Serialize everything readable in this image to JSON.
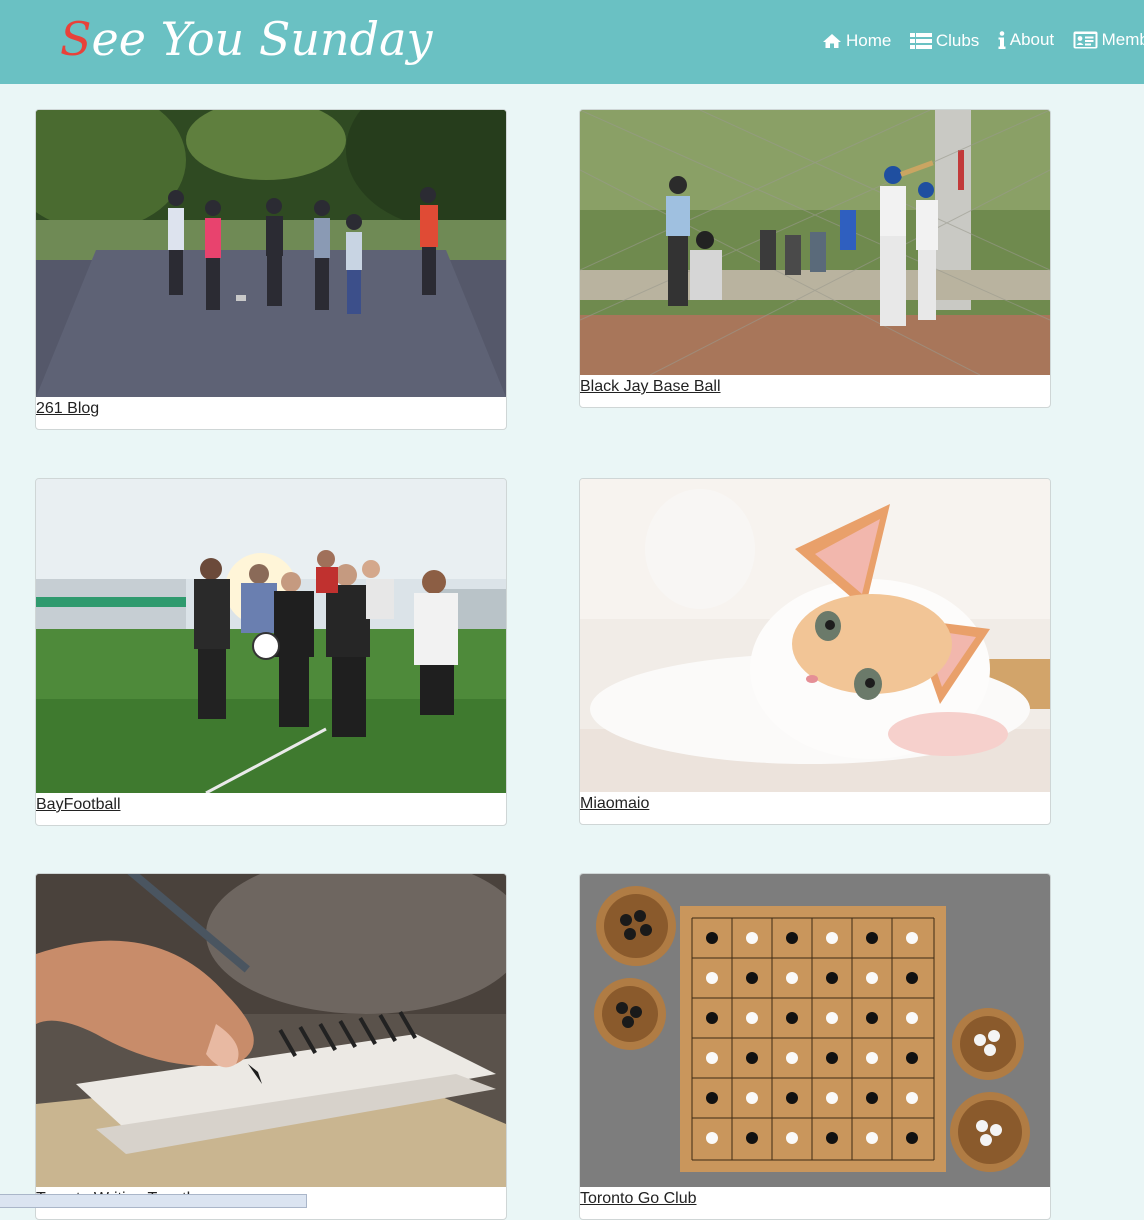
{
  "brand": {
    "first_letter": "S",
    "rest": "ee You Sunday"
  },
  "nav": {
    "home": "Home",
    "clubs": "Clubs",
    "about": "About",
    "members": "Membe"
  },
  "clubs": [
    {
      "name": "261 Blog"
    },
    {
      "name": "Black Jay Base Ball"
    },
    {
      "name": "BayFootball"
    },
    {
      "name": "Miaomaio"
    },
    {
      "name": "Toronto Writing Together"
    },
    {
      "name": "Toronto Go Club"
    }
  ],
  "colors": {
    "navbar": "#6ac1c3",
    "brand_accent": "#e8423a",
    "background": "#eaf6f6"
  }
}
